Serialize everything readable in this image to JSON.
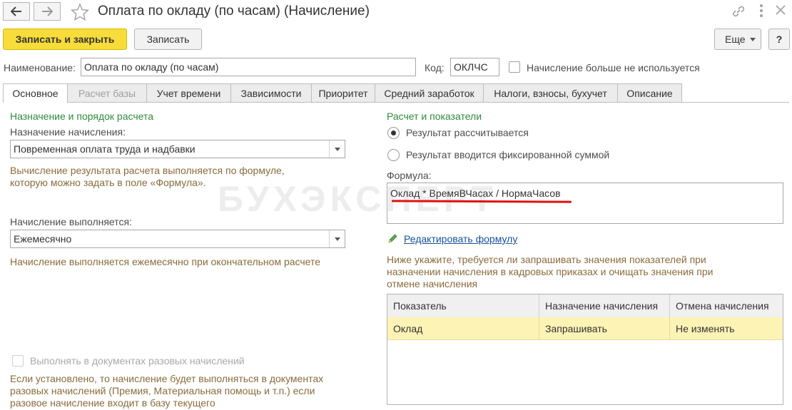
{
  "window": {
    "title": "Оплата по окладу (по часам) (Начисление)"
  },
  "toolbar": {
    "save_close_label": "Записать и закрыть",
    "save_label": "Записать",
    "more_label": "Еще",
    "help_label": "?"
  },
  "header": {
    "name_label": "Наименование:",
    "name_value": "Оплата по окладу (по часам)",
    "code_label": "Код:",
    "code_value": "ОКЛЧС",
    "unused_label": "Начисление больше не используется"
  },
  "tabs": [
    {
      "label": "Основное",
      "state": "active"
    },
    {
      "label": "Расчет базы",
      "state": "disabled"
    },
    {
      "label": "Учет времени",
      "state": "normal"
    },
    {
      "label": "Зависимости",
      "state": "normal"
    },
    {
      "label": "Приоритет",
      "state": "normal"
    },
    {
      "label": "Средний заработок",
      "state": "normal"
    },
    {
      "label": "Налоги, взносы, бухучет",
      "state": "normal"
    },
    {
      "label": "Описание",
      "state": "normal"
    }
  ],
  "left": {
    "section_title": "Назначение и порядок расчета",
    "purpose_label": "Назначение начисления:",
    "purpose_value": "Повременная оплата труда и надбавки",
    "purpose_hint": "Вычисление результата расчета выполняется по формуле, которую можно задать в поле «Формула».",
    "period_label": "Начисление выполняется:",
    "period_value": "Ежемесячно",
    "period_hint": "Начисление выполняется ежемесячно при окончательном расчете",
    "onetime_label": "Выполнять в документах разовых начислений",
    "onetime_hint": "Если установлено, то начисление будет выполняться в документах разовых начислений (Премия, Материальная помощь и т.п.) если разовое начисление входит в базу текущего"
  },
  "right": {
    "section_title": "Расчет и показатели",
    "radio_calc": "Результат рассчитывается",
    "radio_fixed": "Результат вводится фиксированной суммой",
    "formula_label": "Формула:",
    "formula_value": "Оклад * ВремяВЧасах / НормаЧасов",
    "edit_formula_link": "Редактировать формулу",
    "indicators_hint": "Ниже укажите, требуется ли запрашивать значения показателей при назначении начисления в кадровых приказах и очищать значения при отмене начисления"
  },
  "grid": {
    "columns": [
      "Показатель",
      "Назначение начисления",
      "Отмена начисления"
    ],
    "rows": [
      [
        "Оклад",
        "Запрашивать",
        "Не изменять"
      ]
    ]
  },
  "watermark": "БУХЭКСПЕРТ",
  "colors": {
    "primary_button": "#f8dc3a",
    "section_title": "#2e8b3d",
    "hint": "#8a6b3b",
    "link": "#1a4f9c",
    "selected_row": "#fdf3b5",
    "formula_underline": "#e01010"
  }
}
